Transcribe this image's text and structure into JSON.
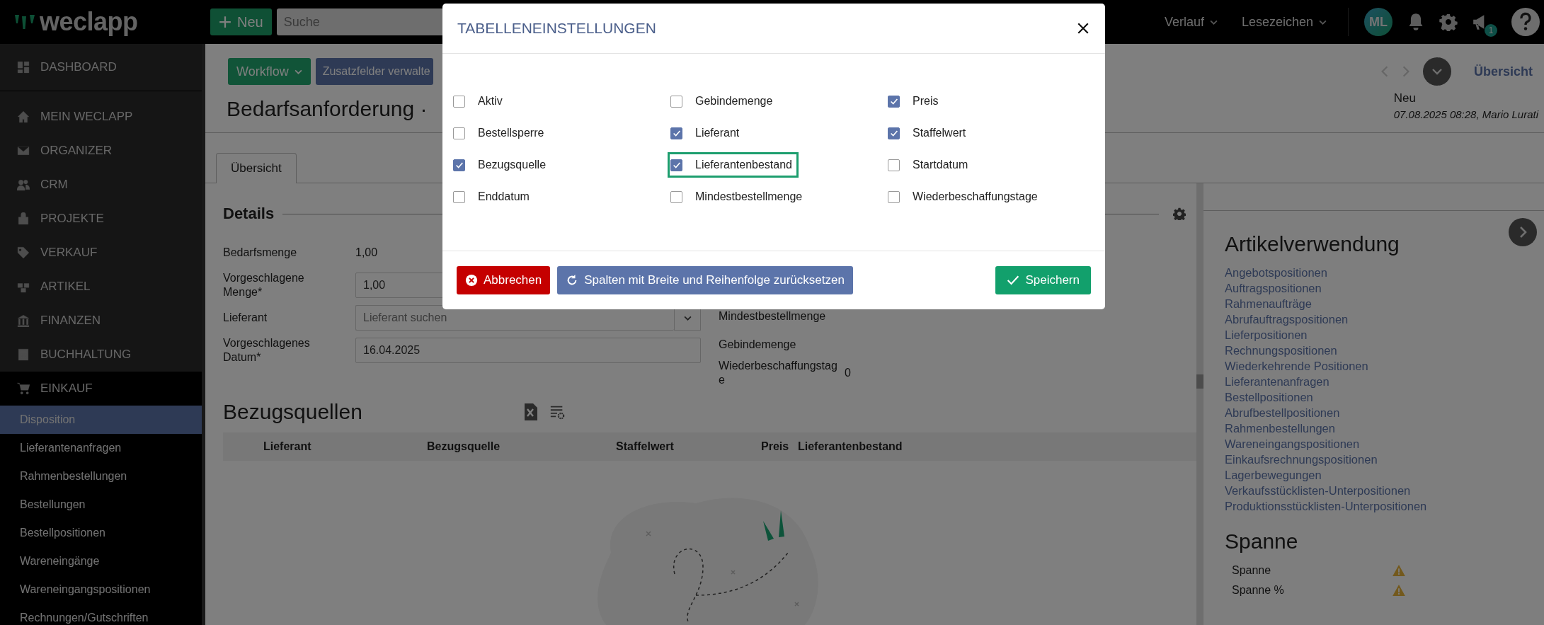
{
  "top_bar": {
    "logo": "weclapp",
    "new_button": "Neu",
    "search": {
      "placeholder": "Suche"
    },
    "menus": [
      {
        "label": "Verlauf"
      },
      {
        "label": "Lesezeichen"
      }
    ],
    "avatar": "ML",
    "announcement_badge": "1"
  },
  "sidebar": {
    "items": [
      {
        "label": "DASHBOARD",
        "expanded": false
      },
      {
        "label": "MEIN WECLAPP",
        "expanded": false
      },
      {
        "label": "ORGANIZER",
        "expanded": false
      },
      {
        "label": "CRM",
        "expanded": false
      },
      {
        "label": "PROJEKTE",
        "expanded": false
      },
      {
        "label": "VERKAUF",
        "expanded": false
      },
      {
        "label": "ARTIKEL",
        "expanded": false
      },
      {
        "label": "FINANZEN",
        "expanded": false
      },
      {
        "label": "BUCHHALTUNG",
        "expanded": false
      },
      {
        "label": "EINKAUF",
        "expanded": true,
        "children": [
          {
            "label": "Disposition",
            "selected": true
          },
          {
            "label": "Lieferantenanfragen",
            "selected": false
          },
          {
            "label": "Rahmenbestellungen",
            "selected": false
          },
          {
            "label": "Bestellungen",
            "selected": false
          },
          {
            "label": "Bestellpositionen",
            "selected": false
          },
          {
            "label": "Wareneingänge",
            "selected": false
          },
          {
            "label": "Wareneingangspositionen",
            "selected": false
          },
          {
            "label": "Rechnungen/Gutschriften",
            "selected": false
          }
        ]
      }
    ]
  },
  "toolbar": {
    "buttons": [
      {
        "label": "Workflow",
        "kind": "dropdown"
      },
      {
        "label": "Zusatzfelder verwalte",
        "kind": "plain"
      }
    ]
  },
  "record": {
    "title": "Bedarfsanforderung ·",
    "status": "Neu",
    "created": "07.08.2025 08:28, Mario Lurati",
    "overview_link": "Übersicht"
  },
  "tabs": [
    {
      "label": "Übersicht",
      "selected": true
    }
  ],
  "details": {
    "title": "Details",
    "left_fields": [
      {
        "label": "Bedarfsmenge",
        "kind": "text",
        "value": "1,00"
      },
      {
        "label": "Vorgeschlagene Menge*",
        "kind": "input",
        "value": "1,00"
      },
      {
        "label": "Lieferant",
        "kind": "select",
        "placeholder": "Lieferant suchen"
      },
      {
        "label": "Vorgeschlagenes Datum*",
        "kind": "input",
        "value": "16.04.2025"
      }
    ],
    "right_fields": [
      {
        "label": "Mindestbestellmenge"
      },
      {
        "label": "Gebindemenge"
      },
      {
        "label": "Wiederbeschaffungstage",
        "value": "0"
      }
    ]
  },
  "sources": {
    "title": "Bezugsquellen",
    "columns": [
      "Lieferant",
      "Bezugsquelle",
      "Staffelwert",
      "Preis",
      "Lieferantenbestand"
    ]
  },
  "usage": {
    "title": "Artikelverwendung",
    "links": [
      "Angebotspositionen",
      "Auftragspositionen",
      "Rahmenaufträge",
      "Abrufauftragspositionen",
      "Lieferpositionen",
      "Rechnungspositionen",
      "Wiederkehrende Positionen",
      "Lieferantenanfragen",
      "Bestellpositionen",
      "Abrufbestellpositionen",
      "Rahmenbestellungen",
      "Wareneingangspositionen",
      "Einkaufsrechnungspositionen",
      "Lagerbewegungen",
      "Verkaufsstücklisten-Unterpositionen",
      "Produktionsstücklisten-Unterpositionen"
    ]
  },
  "margin": {
    "title": "Spanne",
    "rows": [
      "Spanne",
      "Spanne %"
    ]
  },
  "dialog": {
    "title": "TABELLENEINSTELLUNGEN",
    "columns": [
      [
        {
          "label": "Aktiv",
          "checked": false,
          "focused": false
        },
        {
          "label": "Bestellsperre",
          "checked": false,
          "focused": false
        },
        {
          "label": "Bezugsquelle",
          "checked": true,
          "focused": false
        },
        {
          "label": "Enddatum",
          "checked": false,
          "focused": false
        }
      ],
      [
        {
          "label": "Gebindemenge",
          "checked": false,
          "focused": false
        },
        {
          "label": "Lieferant",
          "checked": true,
          "focused": false
        },
        {
          "label": "Lieferantenbestand",
          "checked": true,
          "focused": true
        },
        {
          "label": "Mindestbestellmenge",
          "checked": false,
          "focused": false
        }
      ],
      [
        {
          "label": "Preis",
          "checked": true,
          "focused": false
        },
        {
          "label": "Staffelwert",
          "checked": true,
          "focused": false
        },
        {
          "label": "Startdatum",
          "checked": false,
          "focused": false
        },
        {
          "label": "Wiederbeschaffungstage",
          "checked": false,
          "focused": false
        }
      ]
    ],
    "buttons": [
      {
        "label": "Abbrechen",
        "kind": "cancel"
      },
      {
        "label": "Spalten mit Breite und Reihenfolge zurücksetzen",
        "kind": "reset"
      },
      {
        "label": "Speichern",
        "kind": "save"
      }
    ]
  }
}
